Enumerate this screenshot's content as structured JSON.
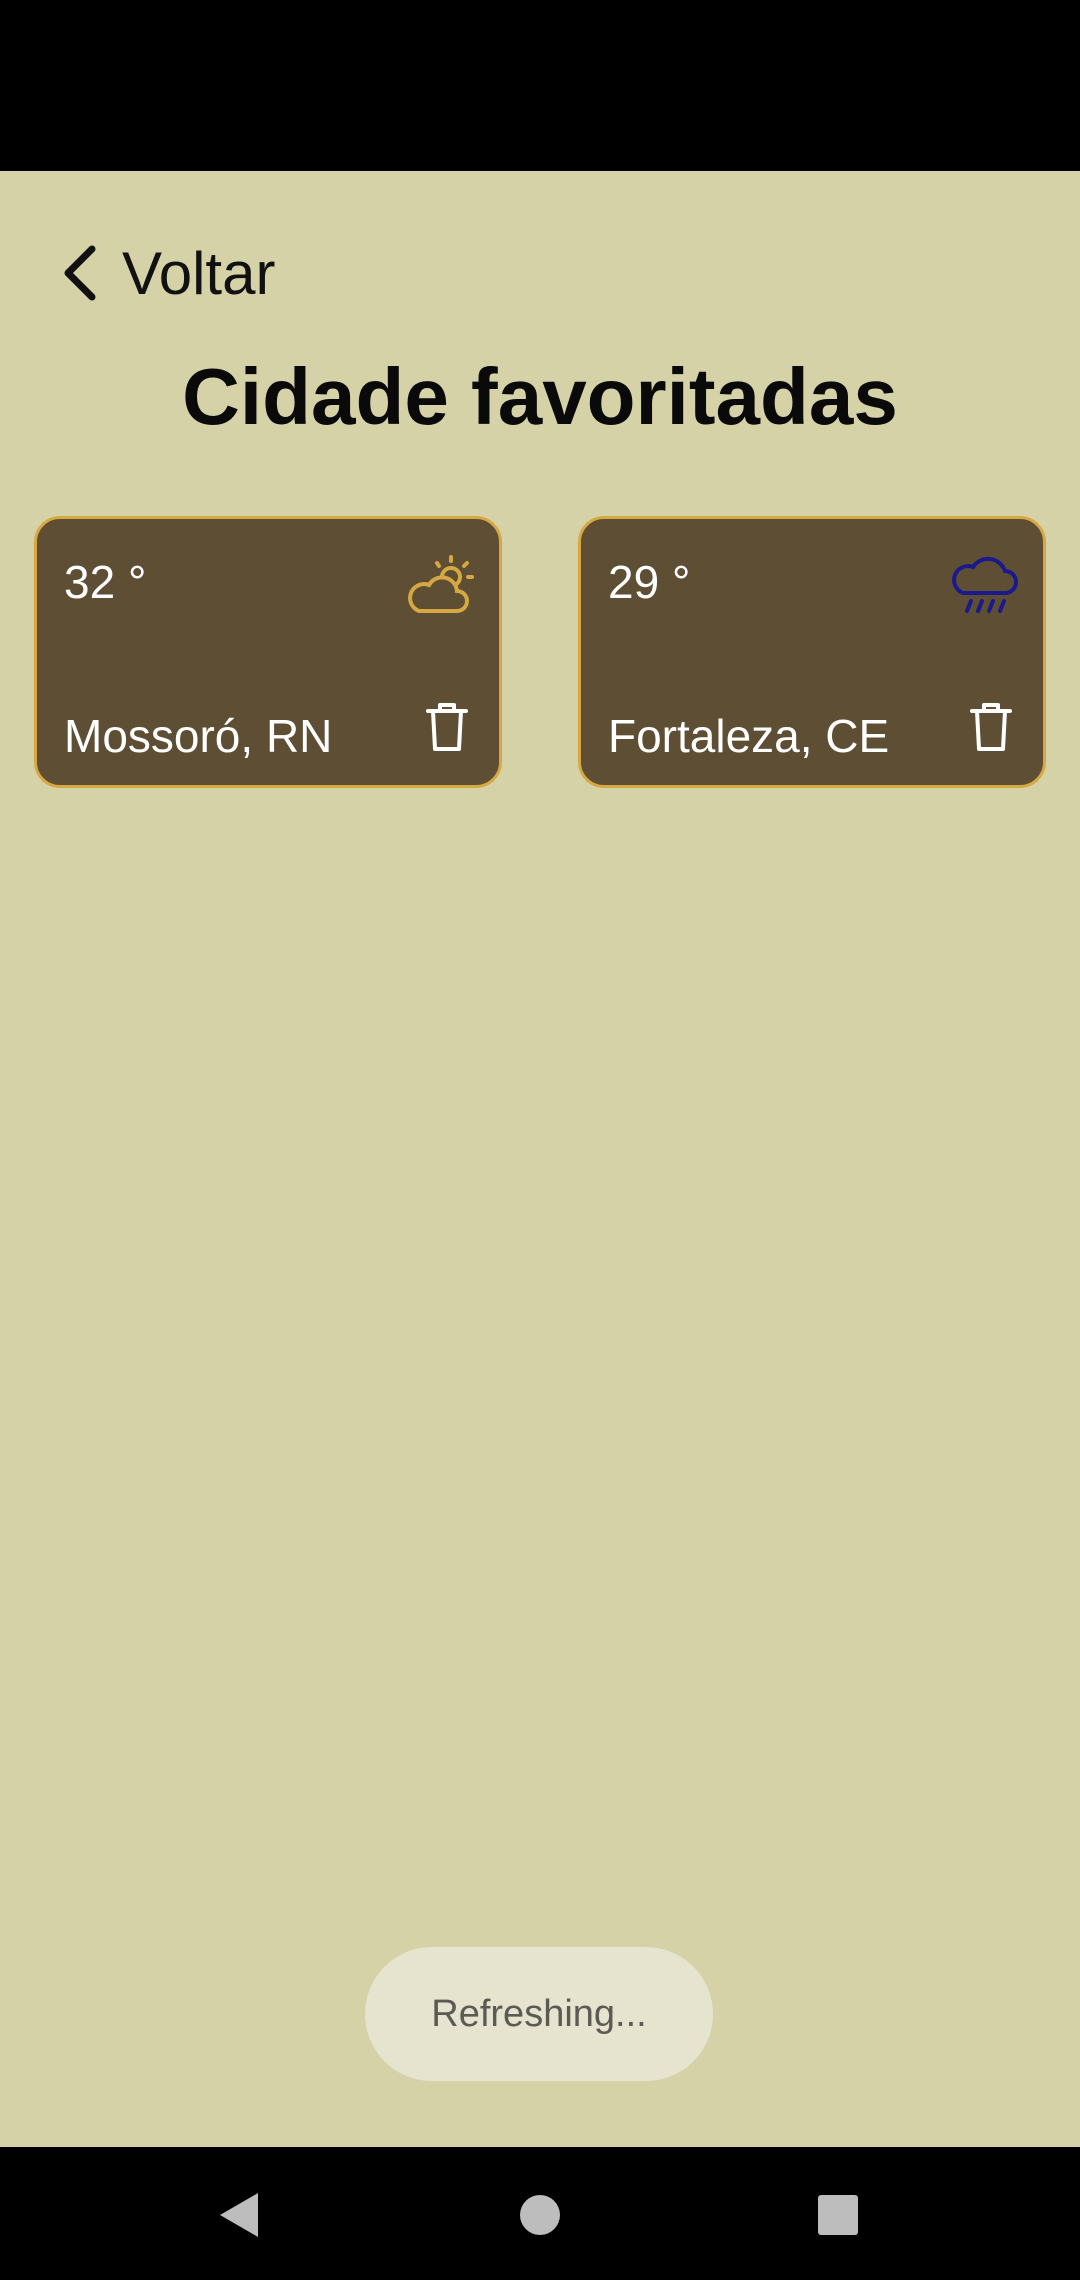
{
  "header": {
    "back_label": "Voltar",
    "title": "Cidade favoritadas"
  },
  "cities": [
    {
      "temperature": "32 °",
      "name": "Mossoró, RN",
      "weather_icon": "partly-cloudy-icon",
      "icon_color": "#d5a843"
    },
    {
      "temperature": "29 °",
      "name": "Fortaleza, CE",
      "weather_icon": "rain-cloud-icon",
      "icon_color": "#1a1a8c"
    }
  ],
  "toast": {
    "text": "Refreshing..."
  },
  "colors": {
    "background": "#d6d2a8",
    "card": "#5e4e34",
    "card_border": "#d5a843"
  },
  "navigation": {
    "buttons": [
      "back-nav-icon",
      "home-nav-icon",
      "recents-nav-icon"
    ]
  }
}
